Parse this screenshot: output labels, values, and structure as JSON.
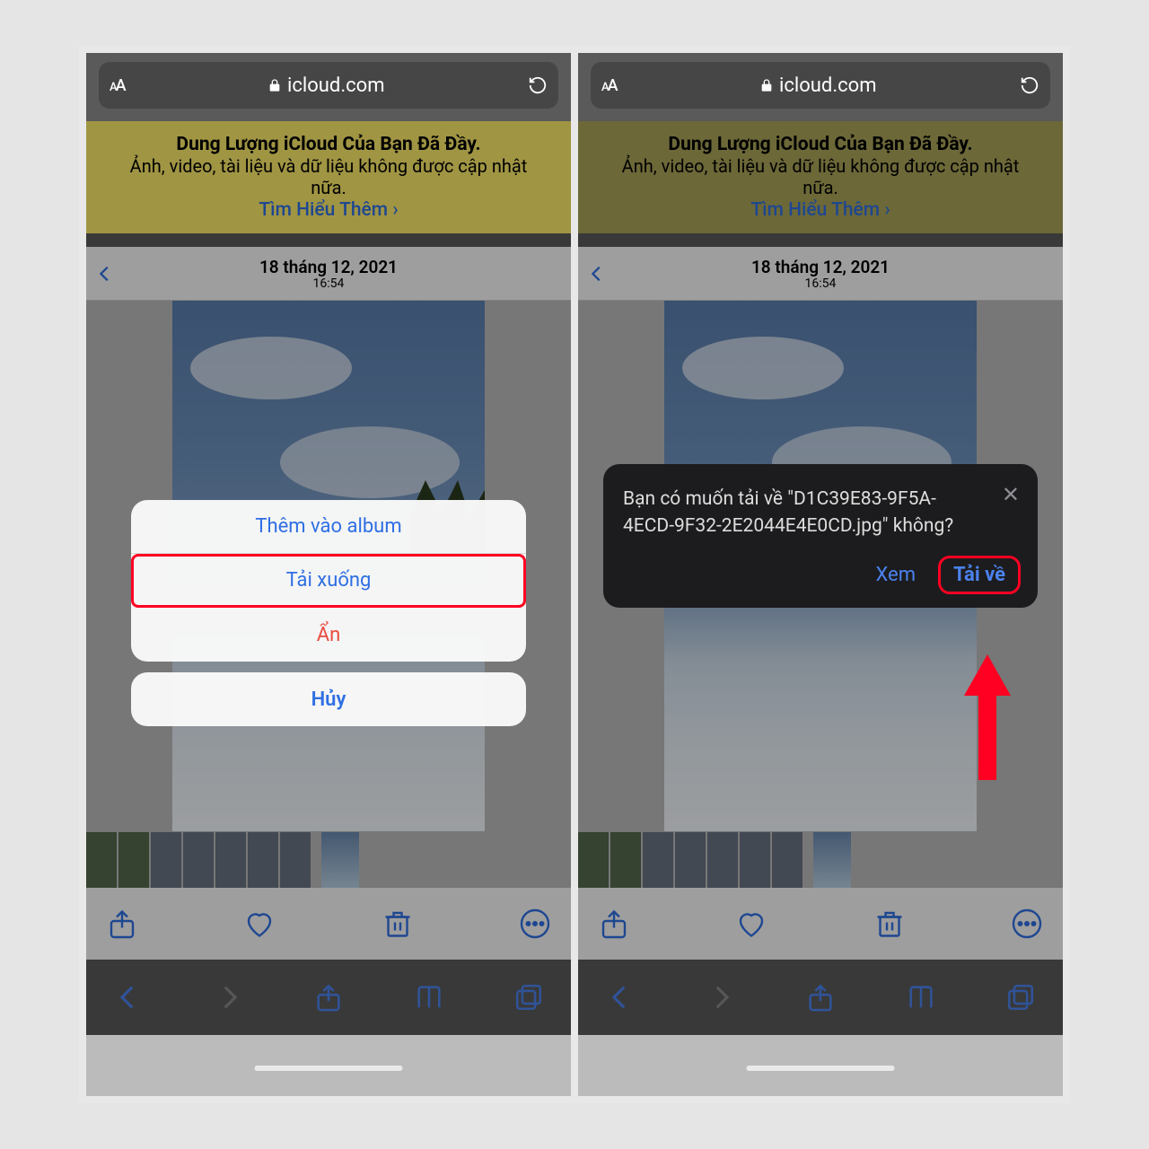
{
  "safari": {
    "url_domain": "icloud.com",
    "aa_label_small": "A",
    "aa_label_big": "A"
  },
  "banner": {
    "title": "Dung Lượng iCloud Của Bạn Đã Đầy.",
    "body": "Ảnh, video, tài liệu và dữ liệu không được cập nhật nữa.",
    "link_label": "Tìm Hiểu Thêm"
  },
  "photo_header": {
    "date": "18 tháng 12, 2021",
    "time": "16:54"
  },
  "action_sheet": {
    "add_to_album": "Thêm vào album",
    "download": "Tải xuống",
    "hide": "Ẩn",
    "cancel": "Hủy"
  },
  "download_prompt": {
    "message": "Bạn có muốn tải về \"D1C39E83-9F5A-4ECD-9F32-2E2044E4E0CD.jpg\" không?",
    "view": "Xem",
    "download": "Tải về",
    "close": "✕"
  }
}
